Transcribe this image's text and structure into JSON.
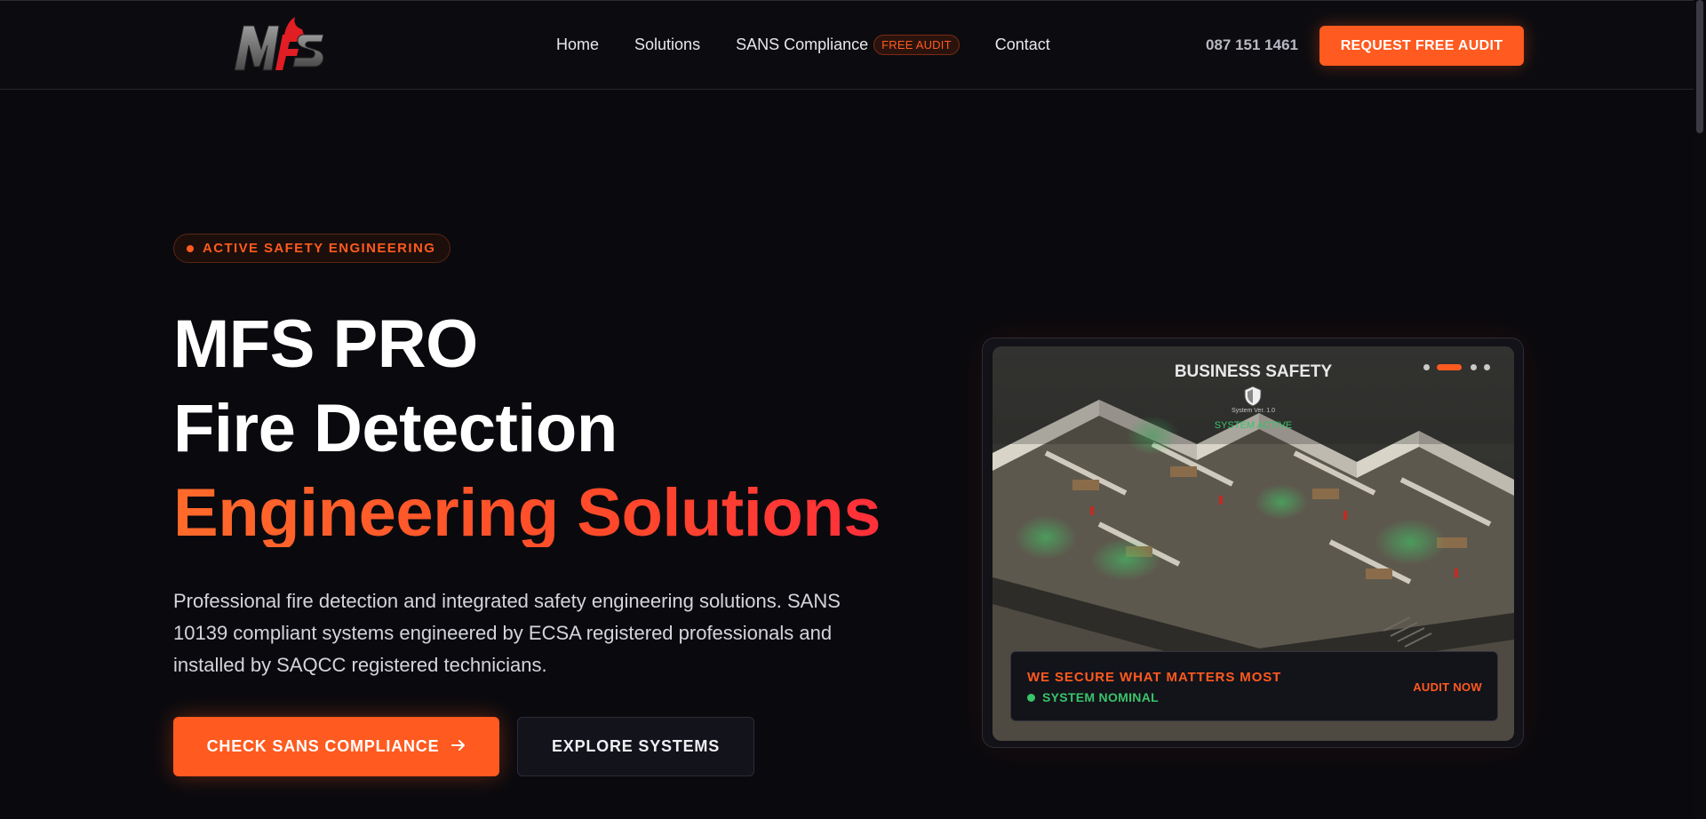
{
  "header": {
    "logo_text": "MFS",
    "nav": [
      {
        "label": "Home"
      },
      {
        "label": "Solutions"
      },
      {
        "label": "SANS Compliance",
        "badge": "FREE AUDIT"
      },
      {
        "label": "Contact"
      }
    ],
    "phone": "087 151 1461",
    "cta_label": "REQUEST FREE AUDIT"
  },
  "hero": {
    "pill_label": "ACTIVE SAFETY ENGINEERING",
    "title_line1": "MFS PRO",
    "title_line2": "Fire Detection",
    "title_line3": "Engineering Solutions",
    "description": "Professional fire detection and integrated safety engineering solutions. SANS 10139 compliant systems engineered by ECSA registered professionals and installed by SAQCC registered technicians.",
    "primary_button": "CHECK SANS COMPLIANCE",
    "secondary_button": "EXPLORE SYSTEMS"
  },
  "card": {
    "image_title": "BUSINESS SAFETY",
    "system_version": "System Ver. 1.0",
    "system_active": "SYSTEM ACTIVE",
    "slide_count": 4,
    "active_slide": 2,
    "bar_title": "WE SECURE WHAT MATTERS MOST",
    "bar_status": "SYSTEM NOMINAL",
    "bar_link": "AUDIT NOW"
  },
  "colors": {
    "accent": "#ff5a1f",
    "background": "#0a0a0e",
    "status_green": "#39c46a"
  },
  "icons": [
    "arrow-right-icon",
    "shield-icon",
    "logo"
  ]
}
